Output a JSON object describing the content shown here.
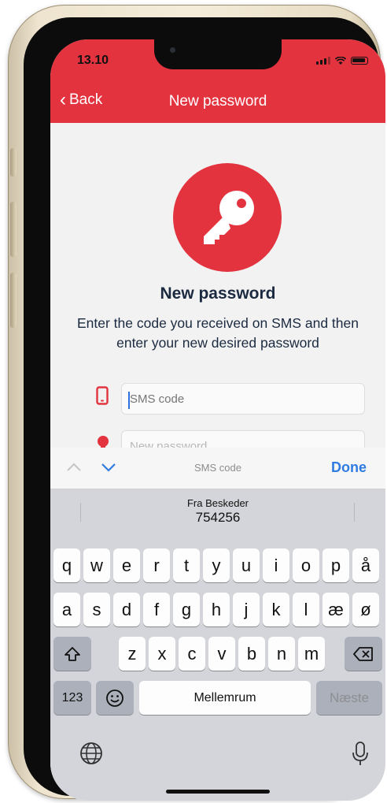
{
  "status": {
    "time": "13.10"
  },
  "nav": {
    "back_label": "Back",
    "title": "New password"
  },
  "main": {
    "heading": "New password",
    "description": "Enter the code you received on SMS and then enter your new desired password",
    "sms_field": {
      "placeholder": "SMS code"
    },
    "password_field": {
      "placeholder": "New password"
    }
  },
  "keyboard": {
    "bar": {
      "field_label": "SMS code",
      "done_label": "Done"
    },
    "suggestion": {
      "from": "Fra Beskeder",
      "code": "754256"
    },
    "row1": [
      "q",
      "w",
      "e",
      "r",
      "t",
      "y",
      "u",
      "i",
      "o",
      "p",
      "å"
    ],
    "row2": [
      "a",
      "s",
      "d",
      "f",
      "g",
      "h",
      "j",
      "k",
      "l",
      "æ",
      "ø"
    ],
    "row3": [
      "z",
      "x",
      "c",
      "v",
      "b",
      "n",
      "m"
    ],
    "numbers_label": "123",
    "space_label": "Mellemrum",
    "next_label": "Næste"
  },
  "colors": {
    "brand": "#e2333f",
    "link": "#2f7be0",
    "text": "#1b2a40"
  },
  "icons": [
    "back-chevron-icon",
    "key-icon",
    "phone-icon",
    "lock-icon",
    "arrow-up-icon",
    "arrow-down-icon",
    "shift-icon",
    "delete-icon",
    "emoji-icon",
    "globe-icon",
    "microphone-icon"
  ]
}
